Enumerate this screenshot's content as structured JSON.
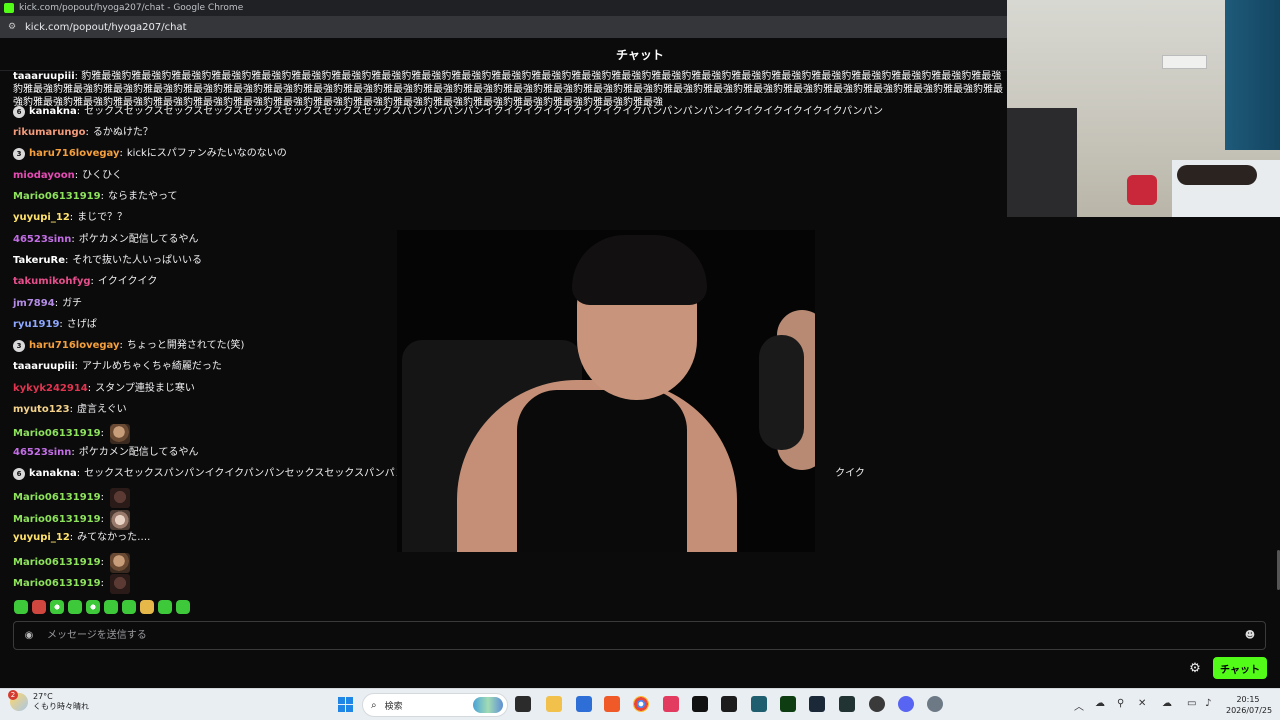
{
  "window": {
    "title": "kick.com/popout/hyoga207/chat - Google Chrome",
    "url": "kick.com/popout/hyoga207/chat"
  },
  "chat": {
    "header_title": "チャット",
    "messages": [
      {
        "user": "taaaruupiii",
        "user_color": "#ffffff",
        "text": "豹雅最強豹雅最強豹雅最強豹雅最強豹雅最強豹雅最強豹雅最強豹雅最強豹雅最強豹雅最強豹雅最強豹雅最強豹雅最強豹雅最強豹雅最強豹雅最強豹雅最強豹雅最強豹雅最強豹雅最強豹雅最強豹雅最強豹雅最強豹雅最強豹雅最強豹雅最強豹雅最強豹雅最強豹雅最強豹雅最強豹雅最強豹雅最強豹雅最強豹雅最強豹雅最強豹雅最強豹雅最強豹雅最強豹雅最強豹雅最強豹雅最強豹雅最強豹雅最強豹雅最強豹雅最強豹雅最強豹雅最強豹雅最強豹雅最強豹雅最強豹雅最強豹雅最強豹雅最強豹雅最強豹雅最強豹雅最強豹雅最強豹雅最強豹雅最強豹雅最強豹雅最強豹雅最強豹雅最強豹雅最強"
      },
      {
        "badge": "6",
        "user": "kanakna",
        "user_color": "#ffffff",
        "text": "セックスセックスセックスセックスセックスセックスセックスセックスパンパンパンパンイクイクイクイクイクイクイクイクパンパンパンパンイクイクイクイクイクイクパンパン"
      },
      {
        "user": "rikumarungo",
        "user_color": "#f39b7a",
        "text": "るかぬけた？"
      },
      {
        "badge": "3",
        "user": "haru716lovegay",
        "user_color": "#f5a03c",
        "text": "kickにスパファンみたいなのないの"
      },
      {
        "user": "miodayoon",
        "user_color": "#e64bb4",
        "text": "ひくひく"
      },
      {
        "user": "Mario06131919",
        "user_color": "#8ee35c",
        "text": "ならまたやって"
      },
      {
        "user": "yuyupi_12",
        "user_color": "#ffe26a",
        "text": "まじで？？"
      },
      {
        "user": "46523sinn",
        "user_color": "#c36ee6",
        "text": "ポケカメン配信してるやん"
      },
      {
        "user": "TakeruRe",
        "user_color": "#ffffff",
        "text": "それで抜いた人いっぱいいる"
      },
      {
        "user": "takumikohfyg",
        "user_color": "#e64f8b",
        "text": "イクイクイク"
      },
      {
        "user": "jm7894",
        "user_color": "#b48ce6",
        "text": "ガチ"
      },
      {
        "user": "ryu1919",
        "user_color": "#8fa8ff",
        "text": "さげぱ"
      },
      {
        "badge": "3",
        "user": "haru716lovegay",
        "user_color": "#f5a03c",
        "text": "ちょっと開発されてた(笑)"
      },
      {
        "user": "taaaruupiii",
        "user_color": "#ffffff",
        "text": "アナルめちゃくちゃ綺麗だった"
      },
      {
        "user": "kykyk242914",
        "user_color": "#e0344f",
        "text": "スタンプ連投まじ寒い"
      },
      {
        "user": "myuto123",
        "user_color": "#f5d38a",
        "text": "虚言えぐい"
      },
      {
        "user": "Mario06131919",
        "user_color": "#8ee35c",
        "text": "",
        "emote": "e-face"
      },
      {
        "user": "46523sinn",
        "user_color": "#c36ee6",
        "text": "ポケカメン配信してるやん"
      },
      {
        "badge": "6",
        "user": "kanakna",
        "user_color": "#ffffff",
        "text": "セックスセックスパンパンイクイクパンパンセックスセックスパンパンイ　　　　　　　　　　　　　　　　　　　　　　　　　　　　　　　　　　　　　　　　　　クイク"
      },
      {
        "user": "Mario06131919",
        "user_color": "#8ee35c",
        "text": "",
        "emote": "e-dark"
      },
      {
        "user": "Mario06131919",
        "user_color": "#8ee35c",
        "text": "",
        "emote": "e-cat"
      },
      {
        "user": "yuyupi_12",
        "user_color": "#ffe26a",
        "text": "みてなかった…."
      },
      {
        "user": "Mario06131919",
        "user_color": "#8ee35c",
        "text": "",
        "emote": "e-face"
      },
      {
        "user": "Mario06131919",
        "user_color": "#8ee35c",
        "text": "",
        "emote": "e-dark"
      }
    ],
    "input_placeholder": "メッセージを送信する",
    "send_label": "チャット"
  },
  "taskbar": {
    "weather_badge": "2",
    "weather_temp": "27°C",
    "weather_desc": "くもり時々晴れ",
    "search_label": "検索",
    "time": "20:15",
    "date": "2026/07/25"
  }
}
